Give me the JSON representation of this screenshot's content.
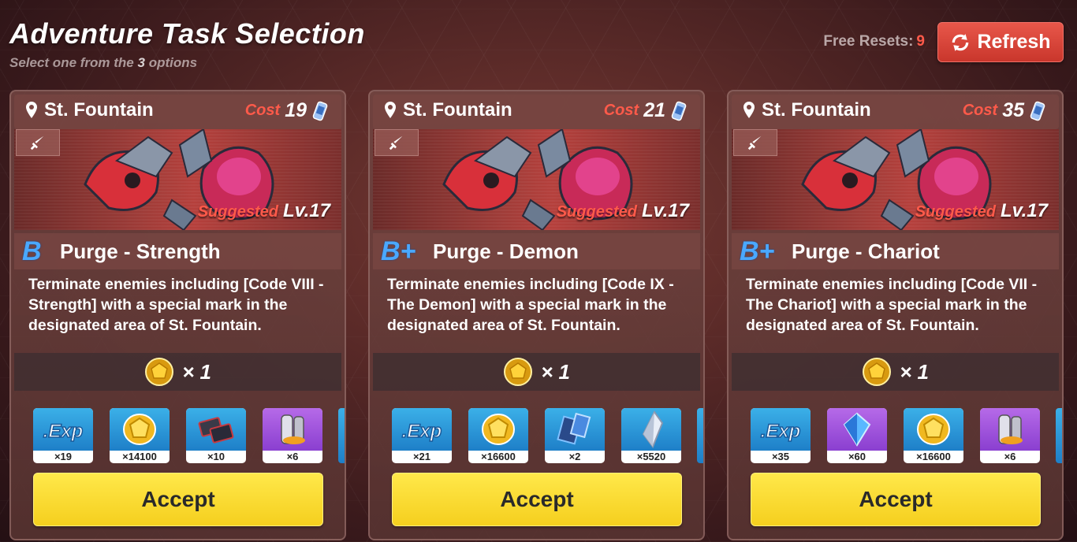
{
  "header": {
    "title": "Adventure Task Selection",
    "subtitle_pre": "Select one from the",
    "subtitle_num": "3",
    "subtitle_post": "options"
  },
  "resets": {
    "label": "Free Resets:",
    "value": "9"
  },
  "refresh": {
    "label": "Refresh",
    "icon": "refresh-icon"
  },
  "colors": {
    "accent_red": "#ff5a4a",
    "accept_yellow": "#f5cf1e",
    "grade_blue": "#4aa8ff"
  },
  "cards": [
    {
      "location": "St. Fountain",
      "cost_label": "Cost",
      "cost_value": "19",
      "suggested_label": "Suggested",
      "suggested_level": "Lv.17",
      "grade": "B",
      "task_name": "Purge - Strength",
      "description": "Terminate enemies including [Code VIII - Strength] with a special mark in the designated area of St. Fountain.",
      "ticket_mult": "× 1",
      "rewards": [
        {
          "icon": "exp-icon",
          "qty": "×19"
        },
        {
          "icon": "gold-coin-icon",
          "qty": "×14100"
        },
        {
          "icon": "chip-icon",
          "qty": "×10"
        },
        {
          "icon": "mech-material-icon",
          "qty": "×6"
        }
      ],
      "accept_label": "Accept"
    },
    {
      "location": "St. Fountain",
      "cost_label": "Cost",
      "cost_value": "21",
      "suggested_label": "Suggested",
      "suggested_level": "Lv.17",
      "grade": "B+",
      "task_name": "Purge - Demon",
      "description": "Terminate enemies including [Code IX - The Demon] with a special mark in the designated area of St. Fountain.",
      "ticket_mult": "× 1",
      "rewards": [
        {
          "icon": "exp-icon",
          "qty": "×21"
        },
        {
          "icon": "gold-coin-icon",
          "qty": "×16600"
        },
        {
          "icon": "weapon-material-icon",
          "qty": "×2"
        },
        {
          "icon": "crystal-shard-icon",
          "qty": "×5520"
        }
      ],
      "accept_label": "Accept"
    },
    {
      "location": "St. Fountain",
      "cost_label": "Cost",
      "cost_value": "35",
      "suggested_label": "Suggested",
      "suggested_level": "Lv.17",
      "grade": "B+",
      "task_name": "Purge - Chariot",
      "description": "Terminate enemies including [Code VII - The Chariot] with a special mark in the designated area of St. Fountain.",
      "ticket_mult": "× 1",
      "rewards": [
        {
          "icon": "exp-icon",
          "qty": "×35"
        },
        {
          "icon": "crystal-icon",
          "qty": "×60"
        },
        {
          "icon": "gold-coin-icon",
          "qty": "×16600"
        },
        {
          "icon": "mech-material-icon",
          "qty": "×6"
        }
      ],
      "accept_label": "Accept"
    }
  ]
}
